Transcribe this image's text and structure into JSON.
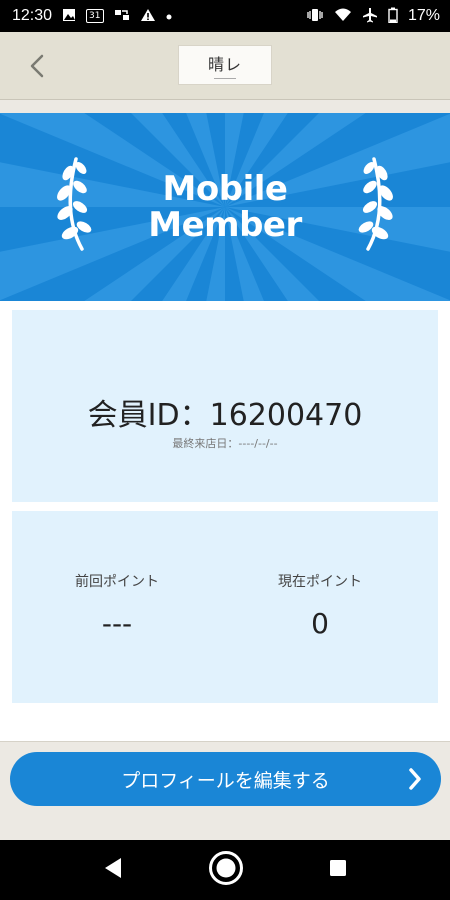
{
  "status_bar": {
    "time": "12:30",
    "calendar_day": "31",
    "battery": "17%"
  },
  "header": {
    "logo_text": "晴レ"
  },
  "banner": {
    "title_line1": "Mobile",
    "title_line2": "Member"
  },
  "member": {
    "id_label": "会員ID：16200470",
    "last_visit": "最終来店日：----/--/--"
  },
  "points": {
    "previous_label": "前回ポイント",
    "previous_value": "---",
    "current_label": "現在ポイント",
    "current_value": "0"
  },
  "actions": {
    "edit_profile_label": "プロフィールを編集する"
  },
  "colors": {
    "primary": "#1a86d6",
    "panel_bg": "#e1f2fd",
    "header_bg": "#e3e0d3"
  }
}
